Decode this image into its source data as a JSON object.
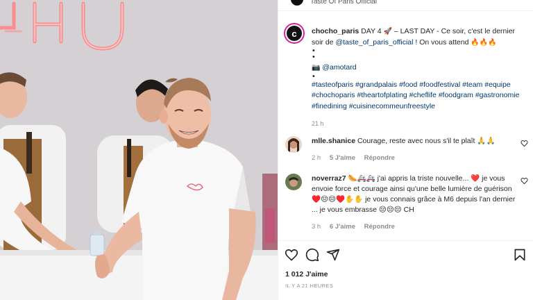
{
  "header": {
    "account": "chocho_paris",
    "partial_text": "Taste Of Paris Official"
  },
  "caption": {
    "username": "chocho_paris",
    "text_1": "DAY 4 ",
    "emoji_rocket": "🚀",
    "text_2": " – LAST DAY - Ce soir, c'est le dernier soir de ",
    "mention": "@taste_of_paris_official",
    "text_3": " ! On vous attend ",
    "emoji_fire": "🔥🔥🔥",
    "dot": "•",
    "camera_emoji": "📷",
    "photo_credit": "@amotard",
    "hashtags": "#tasteofparis #grandpalais #food #foodfestival #team #equipe #chochoparis #theartofplating #cheflife #foodgram #gastronomie #finedining #cuisinecommeunfreestyle",
    "time": "21 h"
  },
  "comments": [
    {
      "username": "mlle.shanice",
      "text": "Courage, reste avec nous s'il te plaît 🙏🙏",
      "time": "2 h",
      "likes": "5 J'aime",
      "reply": "Répondre"
    },
    {
      "username": "noverraz7",
      "text": "🌭🚑🚑 j'ai appris la triste nouvelle... ❤️ je vous envoie force et courage ainsi qu'une belle lumière de guérison ♥️😔😔♥️✋✋ je vous connais grâce à M6 depuis l'an dernier ... je vous embrasse 😔😔😔 CH",
      "time": "3 h",
      "likes": "6 J'aime",
      "reply": "Répondre"
    }
  ],
  "actions": {
    "like_icon": "heart-icon",
    "comment_icon": "comment-icon",
    "share_icon": "share-icon",
    "save_icon": "bookmark-icon",
    "likes_count": "1 012 J'aime",
    "posted": "IL Y A 21 HEURES"
  },
  "photo": {
    "neon_text": "CHO",
    "accent": "#ff6b6b"
  }
}
